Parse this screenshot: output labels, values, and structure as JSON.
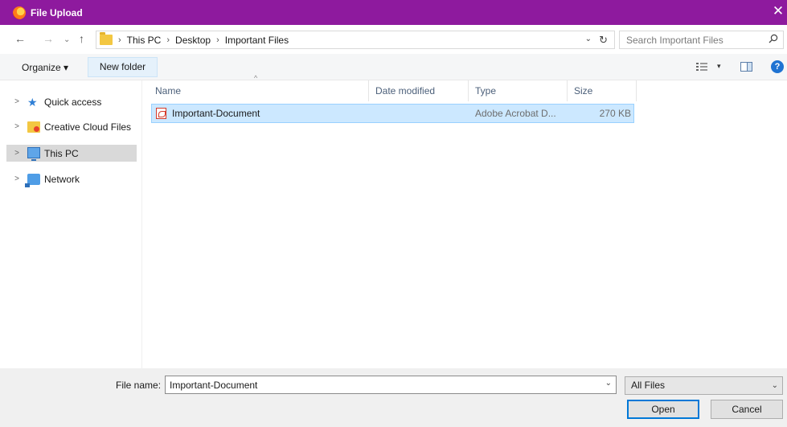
{
  "window": {
    "title": "File Upload",
    "close_glyph": "✕",
    "app_icon": "firefox-icon"
  },
  "address_bar": {
    "back_glyph": "←",
    "forward_glyph": "→",
    "recent_glyph": "⌄",
    "up_glyph": "↑",
    "separator": "›",
    "breadcrumbs": [
      "This PC",
      "Desktop",
      "Important Files"
    ],
    "dropdown_glyph": "⌄",
    "refresh_glyph": "↻"
  },
  "search": {
    "placeholder": "Search Important Files"
  },
  "toolbar": {
    "organize_label": "Organize ▾",
    "new_folder_label": "New folder",
    "view_dropdown_glyph": "▾",
    "help_glyph": "?"
  },
  "nav_pane": {
    "items": [
      {
        "label": "Quick access",
        "icon": "star-icon",
        "chevron": ">"
      },
      {
        "label": "Creative Cloud Files",
        "icon": "creative-cloud-folder-icon",
        "chevron": ">"
      },
      {
        "label": "This PC",
        "icon": "this-pc-icon",
        "chevron": ">",
        "selected": true
      },
      {
        "label": "Network",
        "icon": "network-icon",
        "chevron": ">"
      }
    ]
  },
  "file_list": {
    "sort_glyph": "^",
    "columns": [
      "Name",
      "Date modified",
      "Type",
      "Size"
    ],
    "rows": [
      {
        "name": "Important-Document",
        "date_modified": "",
        "type": "Adobe Acrobat D...",
        "size": "270 KB",
        "icon": "pdf-file-icon",
        "selected": true
      }
    ]
  },
  "bottom": {
    "file_name_label": "File name:",
    "file_name_value": "Important-Document",
    "dropdown_glyph": "⌄",
    "filter_value": "All Files",
    "open_label": "Open",
    "cancel_label": "Cancel"
  },
  "colors": {
    "titlebar": "#8e1a9e",
    "selection": "#cce8ff",
    "primary_button_border": "#0078d7"
  }
}
